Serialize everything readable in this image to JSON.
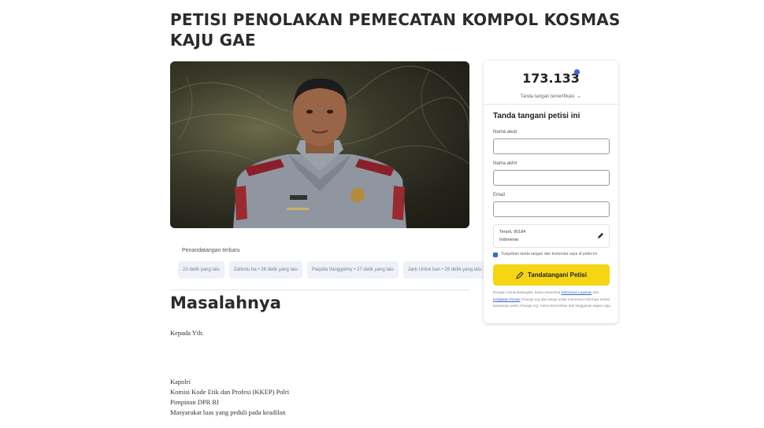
{
  "petition": {
    "title": "PETISI PENOLAKAN PEMECATAN KOMPOL KOSMAS KAJU GAE"
  },
  "recent_signers": {
    "label": "Penandatangan terbaru",
    "items": [
      "23 detik yang lalu",
      "Zahrotu ba • 26 detik yang lalu",
      "Paquita Ifanggatmy • 27 detik yang lalu",
      "Jack Untuk ban • 28 detik yang lalu"
    ]
  },
  "article": {
    "section_title": "Masalahnya",
    "greeting": "Kepada Yth.",
    "recipients": [
      "Kapolri",
      "Komisi Kode Etik dan Profesi (KKEP) Polri",
      "Pimpinan DPR RI",
      "Masyarakat luas yang peduli pada keadilan"
    ]
  },
  "sign_card": {
    "count": "173.133",
    "count_sub": "Tanda tangan terverifikasi",
    "heading": "Tanda tangani petisi ini",
    "fields": {
      "first_name": "Nama awal",
      "last_name": "Nama akhir",
      "email": "Email"
    },
    "location": {
      "line1": "Terarii, 90184",
      "line2": "Indonesia"
    },
    "checkbox_label": "Tunjukkan tanda tangan dan komentar saya di petisi ini",
    "button_label": "Tandatangani Petisi",
    "fineprint_before": "Dengan menandatangani, kamu menerima",
    "fineprint_link1": "Ketentuan Layanan",
    "fineprint_mid": "dan",
    "fineprint_link2": "Kebijakan Privasi",
    "fineprint_after": "Change.org dan setuju untuk menerima informasi terkait kampanye petisi Change.org. Kamu bisa keluar dari langganan kapan saja."
  },
  "colors": {
    "accent_blue": "#3c66d9",
    "button_yellow": "#f6d514"
  }
}
